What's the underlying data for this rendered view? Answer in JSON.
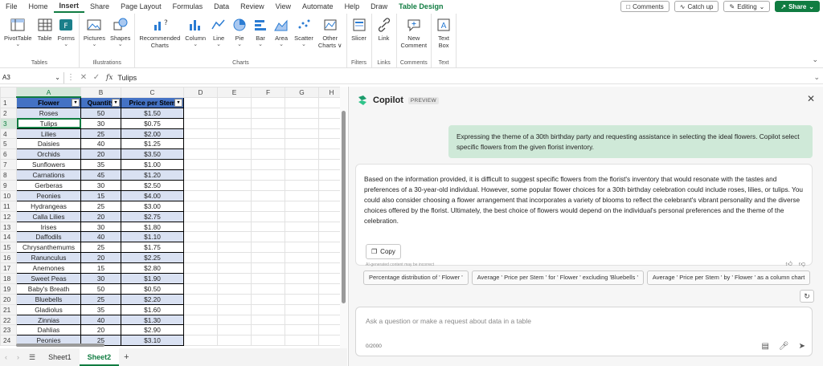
{
  "menu": {
    "items": [
      "File",
      "Home",
      "Insert",
      "Share",
      "Page Layout",
      "Formulas",
      "Data",
      "Review",
      "View",
      "Automate",
      "Help",
      "Draw",
      "Table Design"
    ],
    "active": "Insert"
  },
  "topright": {
    "comments": "Comments",
    "catchup": "Catch up",
    "editing": "Editing",
    "share": "Share"
  },
  "ribbon": {
    "groups": [
      {
        "label": "Tables",
        "buttons": [
          {
            "label": "PivotTable",
            "caret": true,
            "icon": "pivottable-icon"
          },
          {
            "label": "Table",
            "icon": "table-icon"
          },
          {
            "label": "Forms",
            "caret": true,
            "icon": "forms-icon"
          }
        ]
      },
      {
        "label": "Illustrations",
        "buttons": [
          {
            "label": "Pictures",
            "caret": true,
            "icon": "pictures-icon"
          },
          {
            "label": "Shapes",
            "caret": true,
            "icon": "shapes-icon"
          }
        ]
      },
      {
        "label": "Charts",
        "buttons": [
          {
            "label": "Recommended",
            "label2": "Charts",
            "icon": "recommended-charts-icon"
          },
          {
            "label": "Column",
            "caret": true,
            "icon": "column-chart-icon"
          },
          {
            "label": "Line",
            "caret": true,
            "icon": "line-chart-icon"
          },
          {
            "label": "Pie",
            "caret": true,
            "icon": "pie-chart-icon"
          },
          {
            "label": "Bar",
            "caret": true,
            "icon": "bar-chart-icon"
          },
          {
            "label": "Area",
            "caret": true,
            "icon": "area-chart-icon"
          },
          {
            "label": "Scatter",
            "caret": true,
            "icon": "scatter-chart-icon"
          },
          {
            "label": "Other",
            "label2": "Charts ∨",
            "icon": "other-charts-icon"
          }
        ]
      },
      {
        "label": "Filters",
        "buttons": [
          {
            "label": "Slicer",
            "icon": "slicer-icon"
          }
        ]
      },
      {
        "label": "Links",
        "buttons": [
          {
            "label": "Link",
            "icon": "link-icon"
          }
        ]
      },
      {
        "label": "Comments",
        "buttons": [
          {
            "label": "New",
            "label2": "Comment",
            "icon": "new-comment-icon"
          }
        ]
      },
      {
        "label": "Text",
        "buttons": [
          {
            "label": "Text",
            "label2": "Box",
            "icon": "text-box-icon"
          }
        ]
      }
    ]
  },
  "formulabar": {
    "namebox": "A3",
    "fx": "fx",
    "content": "Tulips"
  },
  "sheet": {
    "columns": [
      "A",
      "B",
      "C",
      "D",
      "E",
      "F",
      "G",
      "H"
    ],
    "selected_col": "A",
    "headers": [
      "Flower",
      "Quantity",
      "Price per Stem"
    ],
    "rows": [
      [
        "Roses",
        "50",
        "$1.50"
      ],
      [
        "Tulips",
        "30",
        "$0.75"
      ],
      [
        "Lilies",
        "25",
        "$2.00"
      ],
      [
        "Daisies",
        "40",
        "$1.25"
      ],
      [
        "Orchids",
        "20",
        "$3.50"
      ],
      [
        "Sunflowers",
        "35",
        "$1.00"
      ],
      [
        "Carnations",
        "45",
        "$1.20"
      ],
      [
        "Gerberas",
        "30",
        "$2.50"
      ],
      [
        "Peonies",
        "15",
        "$4.00"
      ],
      [
        "Hydrangeas",
        "25",
        "$3.00"
      ],
      [
        "Calla Lilies",
        "20",
        "$2.75"
      ],
      [
        "Irises",
        "30",
        "$1.80"
      ],
      [
        "Daffodils",
        "40",
        "$1.10"
      ],
      [
        "Chrysanthemums",
        "25",
        "$1.75"
      ],
      [
        "Ranunculus",
        "20",
        "$2.25"
      ],
      [
        "Anemones",
        "15",
        "$2.80"
      ],
      [
        "Sweet Peas",
        "30",
        "$1.90"
      ],
      [
        "Baby's Breath",
        "50",
        "$0.50"
      ],
      [
        "Bluebells",
        "25",
        "$2.20"
      ],
      [
        "Gladiolus",
        "35",
        "$1.60"
      ],
      [
        "Zinnias",
        "40",
        "$1.30"
      ],
      [
        "Dahlias",
        "20",
        "$2.90"
      ],
      [
        "Peonies",
        "25",
        "$3.10"
      ]
    ],
    "active_row": 3
  },
  "tabs": {
    "items": [
      "Sheet1",
      "Sheet2"
    ],
    "active": "Sheet2",
    "add": "+"
  },
  "copilot": {
    "title": "Copilot",
    "badge": "PREVIEW",
    "user_message": "Expressing the theme of a 30th birthday party and requesting assistance in selecting the ideal flowers. Copilot select specific flowers from the given florist inventory.",
    "answer": "Based on the information provided, it is difficult to suggest specific flowers from the florist's inventory that would resonate with the tastes and preferences of a 30-year-old individual. However, some popular flower choices for a 30th birthday celebration could include roses, lilies, or tulips. You could also consider choosing a flower arrangement that incorporates a variety of blooms to reflect the celebrant's vibrant personality and the diverse choices offered by the florist. Ultimately, the best choice of flowers would depend on the individual's personal preferences and the theme of the celebration.",
    "copy_label": "Copy",
    "disclaimer": "AI-generated content may be incorrect",
    "suggestions": [
      "Percentage distribution of ' Flower '",
      "Average ' Price per Stem ' for ' Flower ' excluding 'Bluebells '",
      "Average ' Price per Stem ' by ' Flower ' as a column chart"
    ],
    "input_placeholder": "Ask a question or make a request about data in a table",
    "char_count": "0/2000"
  },
  "colors": {
    "accent": "#107c41",
    "table_header": "#4472c4",
    "table_band": "#d9e1f2",
    "user_bubble": "#cfe9d8"
  }
}
